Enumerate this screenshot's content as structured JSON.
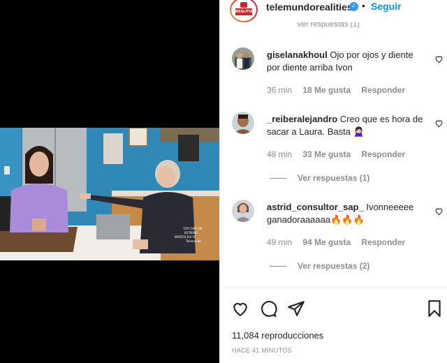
{
  "header": {
    "account": "telemundorealities",
    "avatar_logo_text": "REALITIES",
    "follow_label": "Seguir",
    "dot": "•"
  },
  "cut_off_replies": "Ver respuestas (1)",
  "comments": [
    {
      "user": "giselanakhoul",
      "text": "Ojo por ojos y diente por diente arriba Ivon",
      "time": "36 min",
      "likes": "18 Me gusta",
      "reply_label": "Responder",
      "view_replies": ""
    },
    {
      "user": "_reiberalejandro",
      "text": "Creo que es hora de sacar a Laura. Basta 🙅🏻‍♀️",
      "time": "48 min",
      "likes": "33 Me gusta",
      "reply_label": "Responder",
      "view_replies": "Ver respuestas (1)"
    },
    {
      "user": "astrid_consultor_sap_",
      "text": "Ivonneeeee ganadoraaaaaa🔥🔥🔥",
      "time": "49 min",
      "likes": "94 Me gusta",
      "reply_label": "Responder",
      "view_replies": "Ver respuestas (2)"
    }
  ],
  "footer": {
    "views": "11,084 reproducciones",
    "time_ago": "HACE 41 MINUTOS"
  },
  "video_overlay": {
    "line1": "TOP CHEF VIP",
    "line2": "ESTRENO",
    "line3": "MARTES 8 8 7C",
    "line4": "Telemundo"
  },
  "icons": [
    "heart-icon",
    "comment-icon",
    "share-icon",
    "bookmark-icon",
    "verified-badge-icon"
  ],
  "colors": {
    "accent": "#0095f6",
    "verified": "#3897f0",
    "muted_text": "#8e8e8e",
    "primary_text": "#262626"
  }
}
